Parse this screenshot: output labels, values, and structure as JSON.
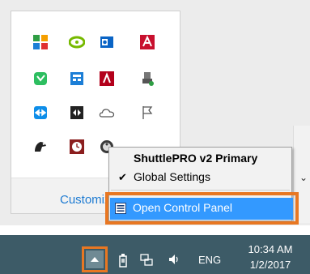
{
  "overflow_flyout": {
    "icons": [
      [
        "colorful-tiles-icon",
        "nvidia-icon",
        "outlook-icon",
        "acrobat-icon"
      ],
      [
        "evernote-icon",
        "calculator-icon",
        "adobe-icon",
        "usb-eject-icon"
      ],
      [
        "teamviewer-icon",
        "arrows-icon",
        "onedrive-icon",
        "flag-icon"
      ],
      [
        "driver-icon",
        "clock-app-icon",
        "shuttlepro-icon",
        ""
      ]
    ],
    "customize_label": "Customize..."
  },
  "context_menu": {
    "title": "ShuttlePRO v2 Primary",
    "global_settings": "Global Settings",
    "open_control_panel": "Open Control Panel"
  },
  "taskbar": {
    "language": "ENG",
    "time": "10:34 AM",
    "date": "1/2/2017"
  },
  "colors": {
    "taskbar": "#3d5b67",
    "highlight": "#3399ff",
    "callout": "#e87722",
    "link": "#1e7bd2"
  }
}
